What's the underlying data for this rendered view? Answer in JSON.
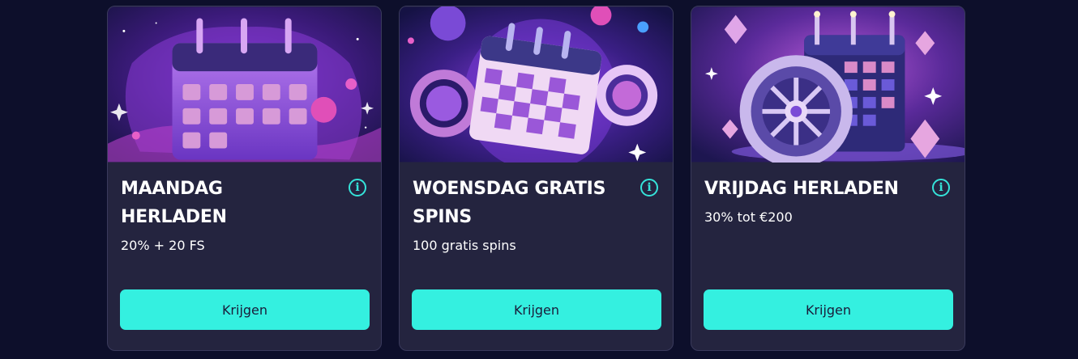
{
  "colors": {
    "page_background": "#0d0f2b",
    "card_background": "#24243f",
    "accent": "#34f0e0",
    "title_text": "#ffffff"
  },
  "promotions": [
    {
      "title": "MAANDAG HERLADEN",
      "description": "20% + 20 FS",
      "cta_label": "Krijgen",
      "info_icon": "info-icon",
      "art_icon": "calendar-illustration"
    },
    {
      "title": "WOENSDAG GRATIS SPINS",
      "description": "100 gratis spins",
      "cta_label": "Krijgen",
      "info_icon": "info-icon",
      "art_icon": "calendar-chips-illustration"
    },
    {
      "title": "VRIJDAG HERLADEN",
      "description": "30% tot €200",
      "cta_label": "Krijgen",
      "info_icon": "info-icon",
      "art_icon": "roulette-calendar-illustration"
    }
  ]
}
